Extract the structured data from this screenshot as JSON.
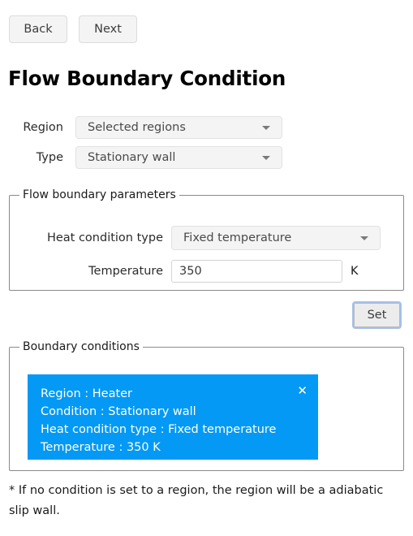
{
  "nav": {
    "back_label": "Back",
    "next_label": "Next"
  },
  "page_title": "Flow Boundary Condition",
  "form": {
    "region": {
      "label": "Region",
      "value": "Selected regions",
      "caret_icon": "chevron-down-icon"
    },
    "type": {
      "label": "Type",
      "value": "Stationary wall",
      "caret_icon": "chevron-down-icon"
    }
  },
  "flow_parameters": {
    "legend": "Flow boundary parameters",
    "heat_condition_type": {
      "label": "Heat condition type",
      "value": "Fixed temperature",
      "caret_icon": "chevron-down-icon"
    },
    "temperature": {
      "label": "Temperature",
      "value": "350",
      "placeholder": "",
      "unit": "K"
    }
  },
  "set_button": {
    "label": "Set"
  },
  "boundary_conditions": {
    "legend": "Boundary conditions",
    "accent_color": "#0399f5",
    "items": [
      {
        "region": "Region : Heater",
        "condition": "Condition : Stationary wall",
        "heat_condition_type": "Heat condition type : Fixed temperature",
        "temperature": "Temperature : 350 K",
        "close_icon": "close-icon",
        "close_glyph": "✕"
      }
    ]
  },
  "footnote": "* If no condition is set to a region, the region will be a adiabatic slip wall."
}
